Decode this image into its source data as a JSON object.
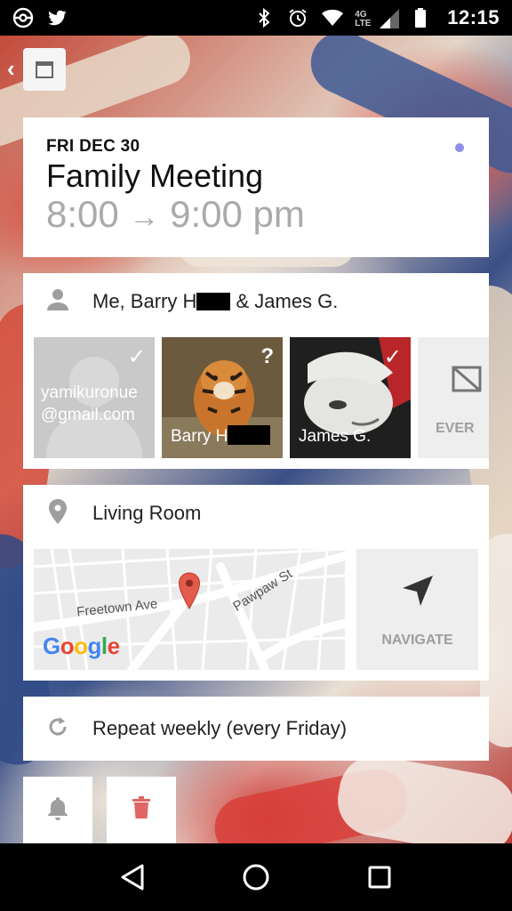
{
  "status_bar": {
    "time": "12:15",
    "left_icons": [
      "pokemon-go-icon",
      "twitter-icon"
    ],
    "right_icons": [
      "bluetooth-icon",
      "alarm-icon",
      "wifi-icon",
      "lte-signal-icon",
      "battery-icon"
    ],
    "network_label": "4G LTE"
  },
  "event": {
    "date": "FRI DEC 30",
    "title": "Family Meeting",
    "time_start": "8:00",
    "arrow": "→",
    "time_end": "9:00 pm",
    "color": "#8f8de6"
  },
  "attendees": {
    "summary_prefix": "Me, Barry H",
    "summary_suffix": " & James G.",
    "tiles": [
      {
        "label": "yamikuronue@gmail.com",
        "status": "✓"
      },
      {
        "label": "Barry H",
        "status": "?"
      },
      {
        "label": "James G.",
        "status": "✓"
      }
    ],
    "more_label": "EVER"
  },
  "location": {
    "name": "Living Room",
    "streets": [
      "Freetown Ave",
      "Pawpaw St"
    ],
    "map_logo": "Google",
    "navigate_label": "NAVIGATE"
  },
  "repeat": {
    "text": "Repeat weekly (every Friday)"
  },
  "actions": {
    "reminder_icon": "bell-icon",
    "delete_icon": "trash-icon",
    "delete_color": "#e06666"
  },
  "colors": {
    "card_bg": "#ffffff",
    "secondary_text": "#aaaaaa",
    "icon_gray": "#9e9e9e"
  }
}
